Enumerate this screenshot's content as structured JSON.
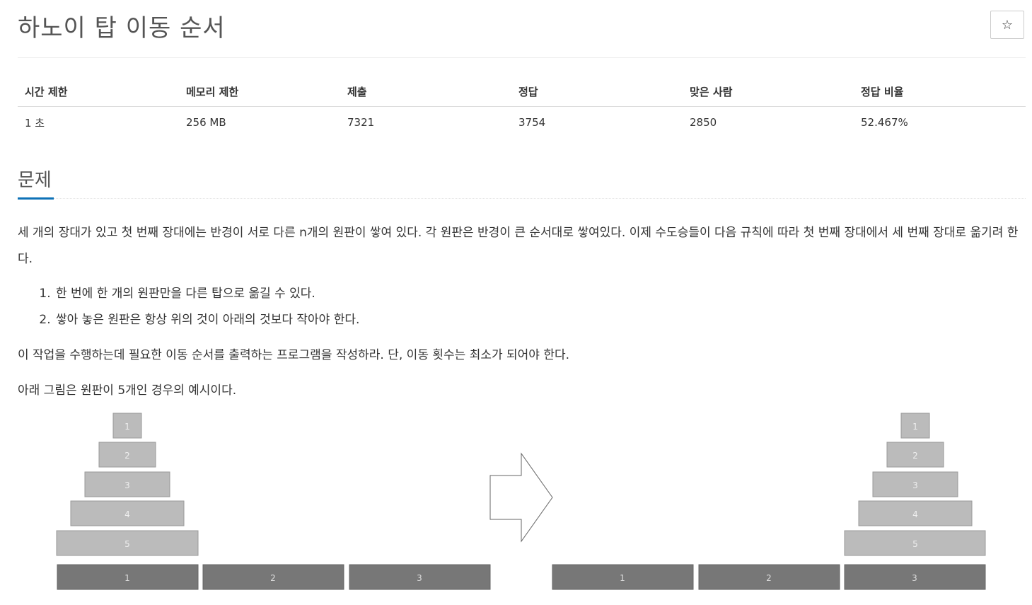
{
  "title": "하노이 탑 이동 순서",
  "star_icon": "☆",
  "stats": {
    "headers": [
      "시간 제한",
      "메모리 제한",
      "제출",
      "정답",
      "맞은 사람",
      "정답 비율"
    ],
    "values": [
      "1 초",
      "256 MB",
      "7321",
      "3754",
      "2850",
      "52.467%"
    ]
  },
  "section": {
    "title": "문제",
    "p1": "세 개의 장대가 있고 첫 번째 장대에는 반경이 서로 다른 n개의 원판이 쌓여 있다. 각 원판은 반경이 큰 순서대로 쌓여있다. 이제 수도승들이 다음 규칙에 따라 첫 번째 장대에서 세 번째 장대로 옮기려 한다.",
    "rules": [
      "한 번에 한 개의 원판만을 다른 탑으로 옮길 수 있다.",
      "쌓아 놓은 원판은 항상 위의 것이 아래의 것보다 작아야 한다."
    ],
    "p2": "이 작업을 수행하는데 필요한 이동 순서를 출력하는 프로그램을 작성하라. 단, 이동 횟수는 최소가 되어야 한다.",
    "p3": "아래 그림은 원판이 5개인 경우의 예시이다."
  },
  "figure": {
    "disk_labels": [
      "1",
      "2",
      "3",
      "4",
      "5"
    ],
    "base_labels": [
      "1",
      "2",
      "3"
    ],
    "arrow_icon": "right-arrow-outline"
  }
}
